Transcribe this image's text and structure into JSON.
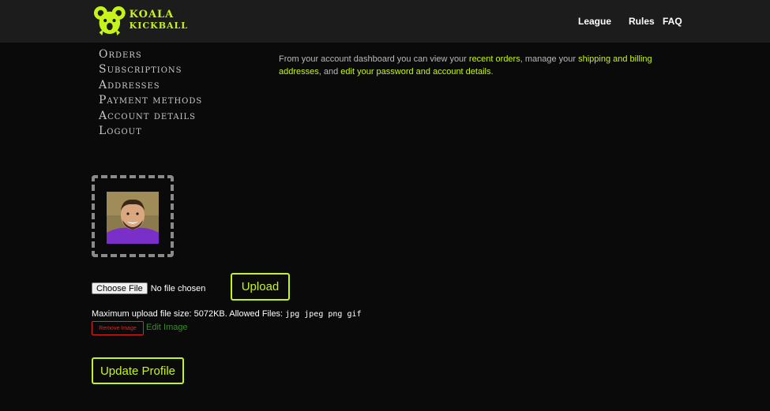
{
  "header": {
    "logo": {
      "line1": "KOALA",
      "line2": "KICKBALL"
    },
    "nav": {
      "league": "League",
      "rules": "Rules",
      "faq": "FAQ"
    }
  },
  "account_menu": [
    "Orders",
    "Subscriptions",
    "Addresses",
    "Payment methods",
    "Account details",
    "Logout"
  ],
  "intro": {
    "t1": "From your account dashboard you can view your ",
    "l1": "recent orders",
    "t2": ", manage your ",
    "l2": "shipping and billing addresses",
    "t3": ", and ",
    "l3": "edit your password and account details",
    "t4": "."
  },
  "upload": {
    "choose_label": "Choose File",
    "no_file": "No file chosen",
    "upload_label": "Upload",
    "max_text": "Maximum upload file size: 5072KB. Allowed Files: ",
    "allowed_types": "jpg jpeg png gif",
    "remove_label": "Remove Image",
    "edit_label": "Edit Image"
  },
  "update_label": "Update Profile",
  "colors": {
    "accent": "#c6f31a",
    "danger": "#e0271f",
    "background": "#0a0a0a",
    "header": "#1c1c1c"
  }
}
